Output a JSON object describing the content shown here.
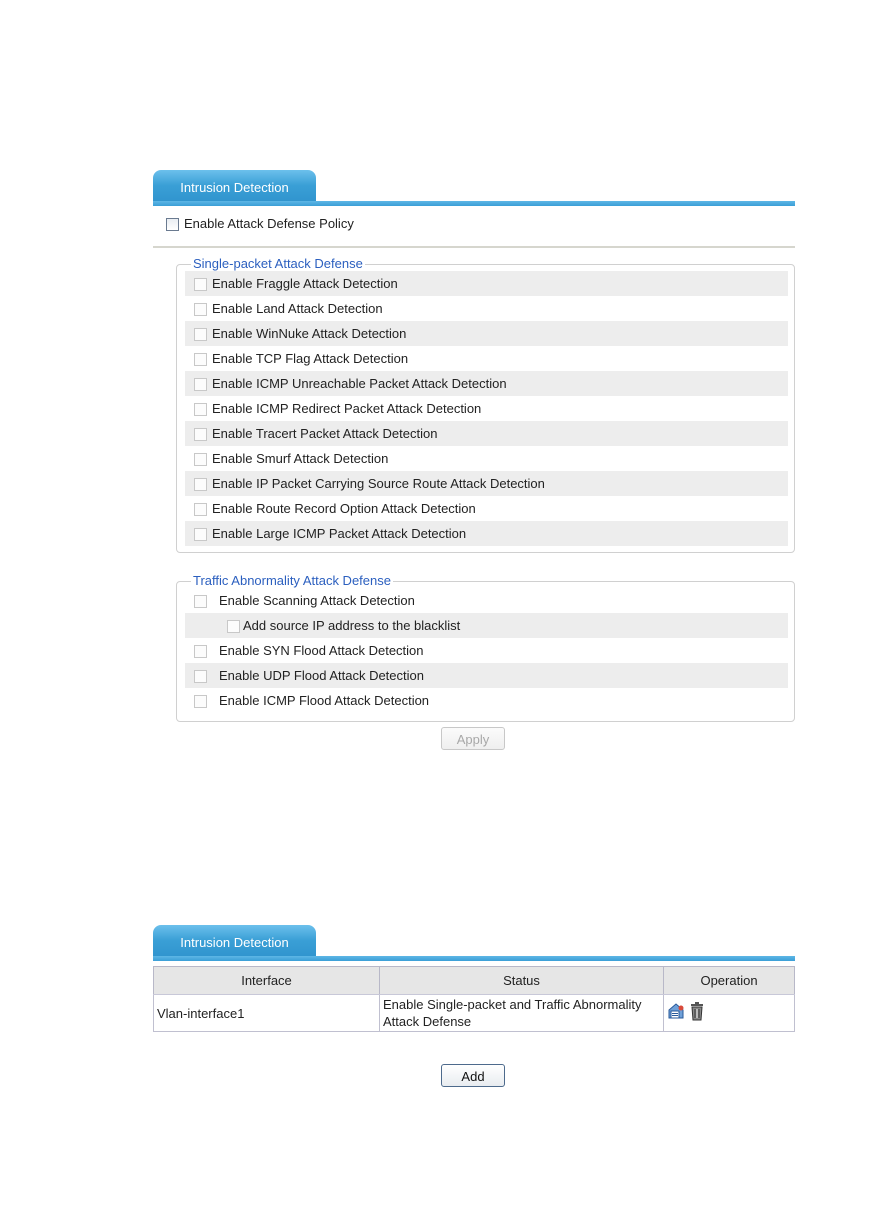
{
  "panel1": {
    "tab_label": "Intrusion Detection",
    "policy_checkbox_label": "Enable Attack Defense Policy",
    "policy_checked": false,
    "single_packet": {
      "legend": "Single-packet Attack Defense",
      "items": [
        {
          "label": "Enable Fraggle Attack Detection",
          "checked": false
        },
        {
          "label": "Enable Land Attack Detection",
          "checked": false
        },
        {
          "label": "Enable WinNuke Attack Detection",
          "checked": false
        },
        {
          "label": "Enable TCP Flag Attack Detection",
          "checked": false
        },
        {
          "label": "Enable ICMP Unreachable Packet Attack Detection",
          "checked": false
        },
        {
          "label": "Enable ICMP Redirect Packet Attack Detection",
          "checked": false
        },
        {
          "label": "Enable Tracert Packet Attack Detection",
          "checked": false
        },
        {
          "label": "Enable Smurf Attack Detection",
          "checked": false
        },
        {
          "label": "Enable IP Packet Carrying Source Route Attack Detection",
          "checked": false
        },
        {
          "label": "Enable Route Record Option Attack Detection",
          "checked": false
        },
        {
          "label": "Enable Large ICMP Packet Attack Detection",
          "checked": false
        }
      ]
    },
    "traffic": {
      "legend": "Traffic Abnormality Attack Defense",
      "items": [
        {
          "label": "Enable Scanning Attack Detection",
          "checked": false
        },
        {
          "label": "Add source IP address to the blacklist",
          "checked": false
        },
        {
          "label": "Enable SYN Flood Attack Detection",
          "checked": false
        },
        {
          "label": "Enable UDP Flood Attack Detection",
          "checked": false
        },
        {
          "label": "Enable ICMP Flood Attack Detection",
          "checked": false
        }
      ]
    },
    "apply_label": "Apply"
  },
  "panel2": {
    "tab_label": "Intrusion Detection",
    "columns": [
      "Interface",
      "Status",
      "Operation"
    ],
    "rows": [
      {
        "interface": "Vlan-interface1",
        "status": "Enable Single-packet and Traffic Abnormality Attack Defense",
        "operations": [
          "edit-icon",
          "delete-icon"
        ]
      }
    ],
    "add_label": "Add"
  },
  "colors": {
    "tab_blue": "#3a9fd6",
    "legend_blue": "#2b5fbf",
    "row_alt": "#ededed"
  }
}
